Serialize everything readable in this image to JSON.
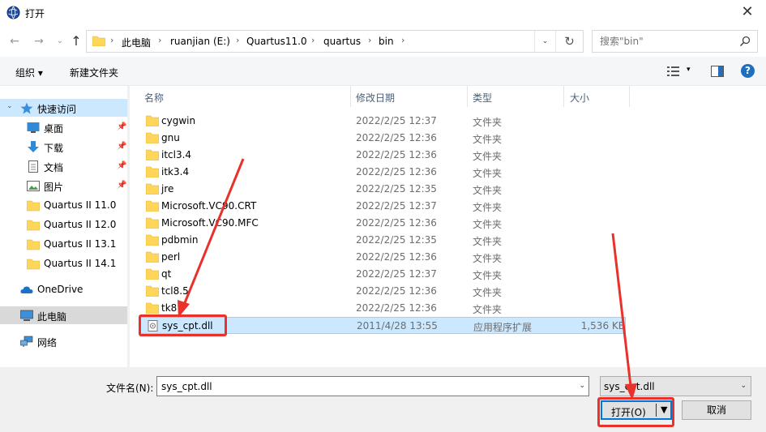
{
  "window": {
    "title": "打开",
    "close_glyph": "✕"
  },
  "nav": {
    "back_glyph": "←",
    "forward_glyph": "→",
    "recent_glyph": "⌄",
    "up_glyph": "↑",
    "breadcrumb": [
      "此电脑",
      "ruanjian (E:)",
      "Quartus11.0",
      "quartus",
      "bin"
    ],
    "sep_glyph": "›",
    "dropdown_glyph": "⌄",
    "refresh_glyph": "↻"
  },
  "search": {
    "placeholder": "搜索\"bin\""
  },
  "toolbar": {
    "organize": "组织 ▾",
    "new_folder": "新建文件夹",
    "view_dd": "▾",
    "help": "?"
  },
  "sidebar": {
    "quick_access": "快速访问",
    "pin_glyph": "📌",
    "items": [
      {
        "label": "桌面"
      },
      {
        "label": "下载"
      },
      {
        "label": "文档"
      },
      {
        "label": "图片"
      },
      {
        "label": "Quartus II 11.0"
      },
      {
        "label": "Quartus II 12.0"
      },
      {
        "label": "Quartus II 13.1"
      },
      {
        "label": "Quartus II 14.1"
      }
    ],
    "onedrive": "OneDrive",
    "this_pc": "此电脑",
    "network": "网络"
  },
  "columns": {
    "name": "名称",
    "modified": "修改日期",
    "type": "类型",
    "size": "大小"
  },
  "files": [
    {
      "name": "cygwin",
      "date": "2022/2/25 12:37",
      "type": "文件夹",
      "size": ""
    },
    {
      "name": "gnu",
      "date": "2022/2/25 12:36",
      "type": "文件夹",
      "size": ""
    },
    {
      "name": "itcl3.4",
      "date": "2022/2/25 12:36",
      "type": "文件夹",
      "size": ""
    },
    {
      "name": "itk3.4",
      "date": "2022/2/25 12:36",
      "type": "文件夹",
      "size": ""
    },
    {
      "name": "jre",
      "date": "2022/2/25 12:35",
      "type": "文件夹",
      "size": ""
    },
    {
      "name": "Microsoft.VC90.CRT",
      "date": "2022/2/25 12:37",
      "type": "文件夹",
      "size": ""
    },
    {
      "name": "Microsoft.VC90.MFC",
      "date": "2022/2/25 12:36",
      "type": "文件夹",
      "size": ""
    },
    {
      "name": "pdbmin",
      "date": "2022/2/25 12:35",
      "type": "文件夹",
      "size": ""
    },
    {
      "name": "perl",
      "date": "2022/2/25 12:36",
      "type": "文件夹",
      "size": ""
    },
    {
      "name": "qt",
      "date": "2022/2/25 12:37",
      "type": "文件夹",
      "size": ""
    },
    {
      "name": "tcl8.5",
      "date": "2022/2/25 12:36",
      "type": "文件夹",
      "size": ""
    },
    {
      "name": "tk8",
      "date": "2022/2/25 12:36",
      "type": "文件夹",
      "size": ""
    },
    {
      "name": "sys_cpt.dll",
      "date": "2011/4/28 13:55",
      "type": "应用程序扩展",
      "size": "1,536 KB"
    }
  ],
  "footer": {
    "filename_label": "文件名(N):",
    "filename_value": "sys_cpt.dll",
    "filter_value": "sys_cpt.dll",
    "dropdown_glyph": "⌄",
    "open_label": "打开(O)",
    "open_dd_glyph": "▼",
    "cancel_label": "取消"
  },
  "colors": {
    "accent": "#0078d7",
    "selection": "#cce8ff",
    "annotation": "#e8322b",
    "folder": "#ffd55a"
  }
}
